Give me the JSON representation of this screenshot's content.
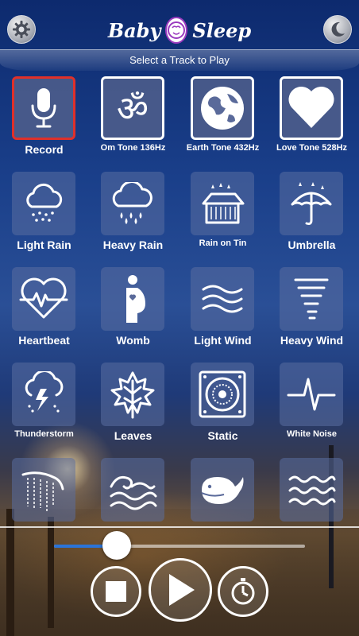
{
  "app": {
    "logo_text_left": "Baby",
    "logo_text_right": "Sleep",
    "subtitle": "Select a Track to Play"
  },
  "tracks": [
    {
      "label": "Record",
      "icon": "microphone-icon"
    },
    {
      "label": "Om Tone 136Hz",
      "icon": "om-icon"
    },
    {
      "label": "Earth Tone 432Hz",
      "icon": "earth-icon"
    },
    {
      "label": "Love Tone 528Hz",
      "icon": "heart-icon"
    },
    {
      "label": "Light Rain",
      "icon": "cloud-light-rain-icon"
    },
    {
      "label": "Heavy Rain",
      "icon": "cloud-heavy-rain-icon"
    },
    {
      "label": "Rain on Tin",
      "icon": "tin-roof-rain-icon"
    },
    {
      "label": "Umbrella",
      "icon": "umbrella-icon"
    },
    {
      "label": "Heartbeat",
      "icon": "heartbeat-icon"
    },
    {
      "label": "Womb",
      "icon": "pregnant-icon"
    },
    {
      "label": "Light Wind",
      "icon": "wind-icon"
    },
    {
      "label": "Heavy Wind",
      "icon": "tornado-icon"
    },
    {
      "label": "Thunderstorm",
      "icon": "thunderstorm-icon"
    },
    {
      "label": "Leaves",
      "icon": "leaf-icon"
    },
    {
      "label": "Static",
      "icon": "speaker-static-icon"
    },
    {
      "label": "White Noise",
      "icon": "pulse-icon"
    },
    {
      "label": "",
      "icon": "waterfall-icon"
    },
    {
      "label": "",
      "icon": "waves-icon"
    },
    {
      "label": "",
      "icon": "whale-icon"
    },
    {
      "label": "",
      "icon": "ocean-waves-icon"
    }
  ],
  "player": {
    "progress": 0.25,
    "accent": "#2b74d8"
  },
  "colors": {
    "record_border": "#e0302a",
    "header_bg": "#0d2a6e"
  }
}
